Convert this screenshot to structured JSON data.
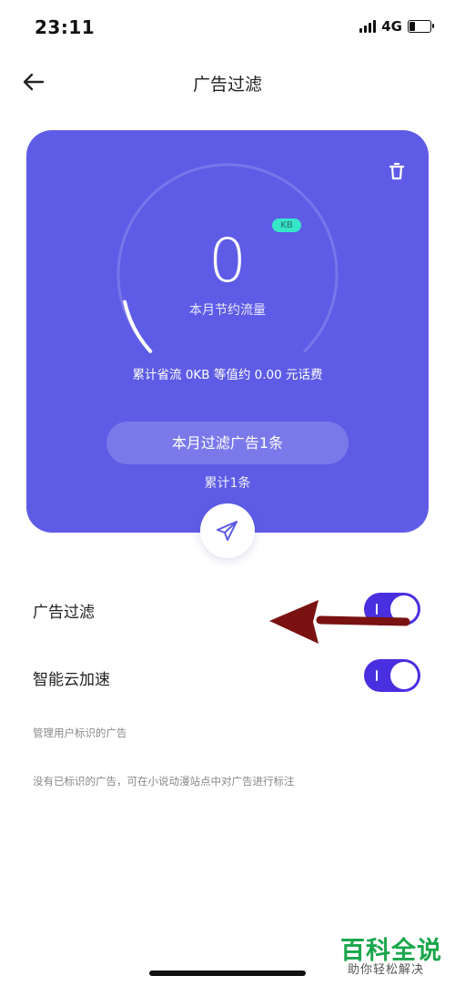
{
  "status_bar": {
    "time": "23:11",
    "network": "4G",
    "battery_level": 0.25
  },
  "header": {
    "title": "广告过滤"
  },
  "card": {
    "saved_value": "0",
    "unit_badge": "KB",
    "saved_label": "本月节约流量",
    "total_info": "累计省流 0KB 等值约 0.00 元话费",
    "filter_button": "本月过滤广告1条",
    "total_count": "累计1条",
    "background_color": "#5e5ce6"
  },
  "settings": {
    "ad_filter_label": "广告过滤",
    "ad_filter_enabled": true,
    "cloud_boost_label": "智能云加速",
    "cloud_boost_enabled": true,
    "manage_note": "管理用户标识的广告",
    "empty_note": "没有已标识的广告，可在小说动漫站点中对广告进行标注"
  },
  "toggle_color": "#4a2fe0",
  "watermark": {
    "main": "百科全说",
    "sub": "助你轻松解决"
  }
}
